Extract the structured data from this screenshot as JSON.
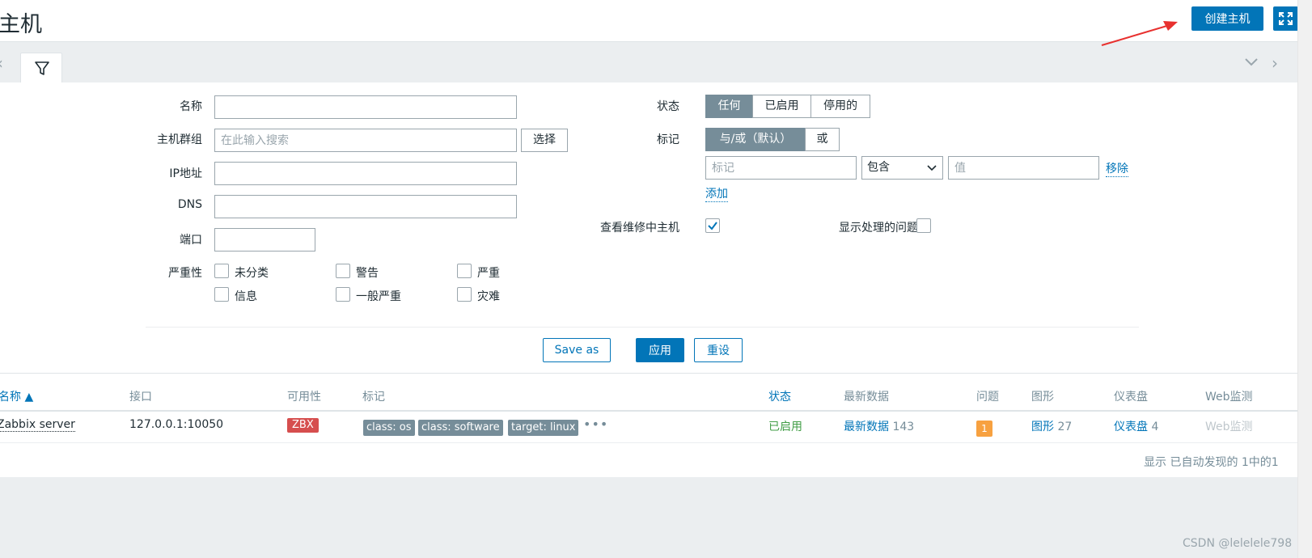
{
  "header": {
    "title": "主机",
    "create_host_label": "创建主机"
  },
  "filter": {
    "labels": {
      "name": "名称",
      "host_groups": "主机群组",
      "ip": "IP地址",
      "dns": "DNS",
      "port": "端口",
      "severity": "严重性",
      "status": "状态",
      "tags": "标记",
      "show_maintenance": "查看维修中主机",
      "show_suppressed": "显示处理的问题"
    },
    "host_group_placeholder": "在此输入搜索",
    "select_label": "选择",
    "status_options": [
      "任何",
      "已启用",
      "停用的"
    ],
    "status_selected": "任何",
    "tag_eval_options": [
      "与/或（默认）",
      "或"
    ],
    "tag_eval_selected": "与/或（默认）",
    "tag_placeholder": "标记",
    "tag_operator": "包含",
    "tag_value_placeholder": "值",
    "remove_label": "移除",
    "add_label": "添加",
    "show_maintenance_checked": true,
    "show_suppressed_checked": false,
    "severities": [
      {
        "label": "未分类",
        "checked": false
      },
      {
        "label": "警告",
        "checked": false
      },
      {
        "label": "严重",
        "checked": false
      },
      {
        "label": "信息",
        "checked": false
      },
      {
        "label": "一般严重",
        "checked": false
      },
      {
        "label": "灾难",
        "checked": false
      }
    ],
    "save_as_label": "Save as",
    "apply_label": "应用",
    "reset_label": "重设"
  },
  "table": {
    "columns": [
      "名称 ▲",
      "接口",
      "可用性",
      "标记",
      "状态",
      "最新数据",
      "问题",
      "图形",
      "仪表盘",
      "Web监测"
    ],
    "rows": [
      {
        "name": "Zabbix server",
        "interface": "127.0.0.1:10050",
        "availability": "ZBX",
        "tags": [
          "class: os",
          "class: software",
          "target: linux"
        ],
        "status": "已启用",
        "latest_data_label": "最新数据",
        "latest_data_count": "143",
        "problems": "1",
        "graphs_label": "图形",
        "graphs_count": "27",
        "dashboards_label": "仪表盘",
        "dashboards_count": "4",
        "web_label": "Web监测"
      }
    ],
    "footer": "显示 已自动发现的 1中的1"
  },
  "watermark": "CSDN @lelelele798",
  "colors": {
    "primary": "#0275b8",
    "enabled": "#429e47",
    "zbx_badge": "#d64e4e",
    "tag": "#768d99",
    "problem": "#f7a140",
    "annotation_arrow": "#e8312f"
  },
  "icons": {
    "filter_tab": "filter-icon",
    "fullscreen": "fullscreen-icon",
    "collapse": "chevron-down-icon",
    "prev": "chevron-left-icon",
    "next": "chevron-right-icon",
    "dropdown": "chevron-down-icon",
    "check": "checkmark-icon"
  }
}
